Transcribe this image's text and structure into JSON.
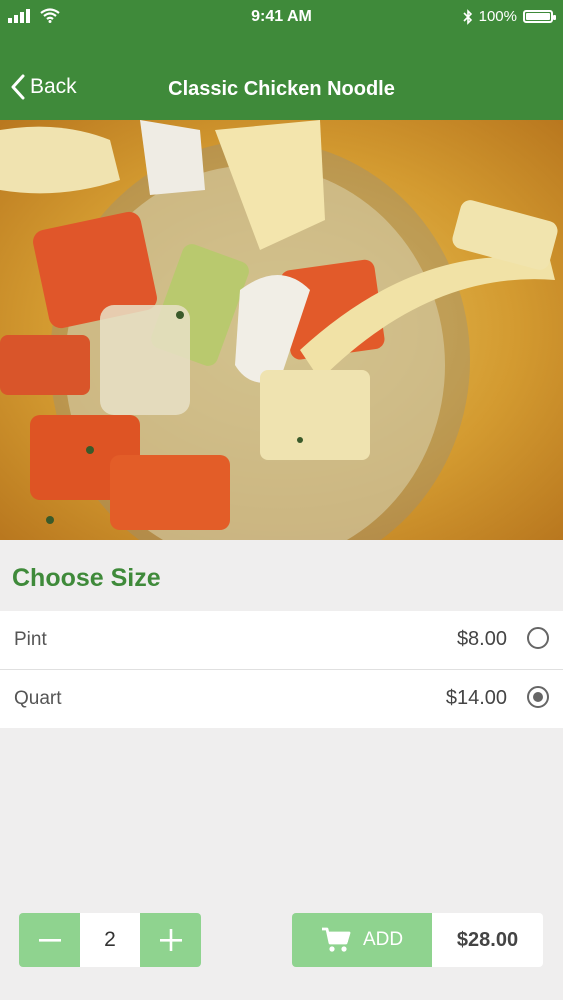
{
  "status_bar": {
    "time": "9:41 AM",
    "battery": "100%"
  },
  "nav": {
    "back_label": "Back",
    "title": "Classic Chicken Noodle"
  },
  "size_section": {
    "title": "Choose Size",
    "options": [
      {
        "name": "Pint",
        "price": "$8.00",
        "selected": false
      },
      {
        "name": "Quart",
        "price": "$14.00",
        "selected": true
      }
    ]
  },
  "order": {
    "quantity": "2",
    "add_label": "ADD",
    "total": "$28.00"
  },
  "colors": {
    "primary": "#3f8a3a",
    "button": "#8fd38f",
    "background": "#efeeee"
  },
  "icons": {
    "signal": "signal-icon",
    "wifi": "wifi-icon",
    "bluetooth": "bluetooth-icon",
    "battery": "battery-icon",
    "back": "chevron-left-icon",
    "cart": "cart-icon",
    "minus": "minus-icon",
    "plus": "plus-icon"
  }
}
